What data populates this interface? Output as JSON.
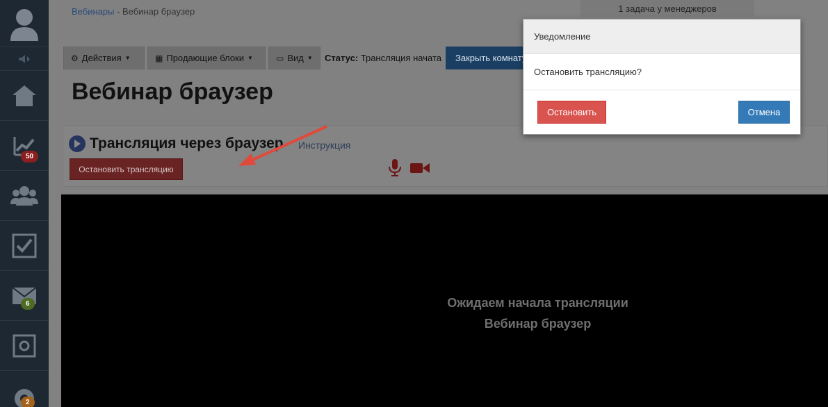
{
  "sidebar": {
    "badges": {
      "stats": "50",
      "messages": "6",
      "support": "2"
    },
    "colors": {
      "stats_badge": "#8b1f1f",
      "messages_badge": "#4d6b25",
      "support_badge": "#a6621a"
    }
  },
  "breadcrumb": {
    "parent": "Вебинары",
    "separator": " - ",
    "current": "Вебинар браузер"
  },
  "tasks": {
    "label": "1 задача у менеджеров"
  },
  "toolbar": {
    "actions_label": "Действия",
    "blocks_label": "Продающие блоки",
    "view_label": "Вид",
    "status_key": "Статус:",
    "status_value": "Трансляция начата",
    "close_room_label": "Закрыть комнату"
  },
  "page": {
    "title": "Вебинар браузер"
  },
  "broadcast": {
    "title": "Трансляция через браузер",
    "instruction_link": "Инструкция",
    "stop_button": "Остановить трансляцию"
  },
  "video": {
    "waiting_text": "Ожидаем начала трансляции",
    "webinar_name": "Вебинар браузер"
  },
  "modal": {
    "title": "Уведомление",
    "message": "Остановить трансляцию?",
    "confirm_label": "Остановить",
    "cancel_label": "Отмена",
    "confirm_color": "#d9534f",
    "cancel_color": "#337ab7"
  }
}
